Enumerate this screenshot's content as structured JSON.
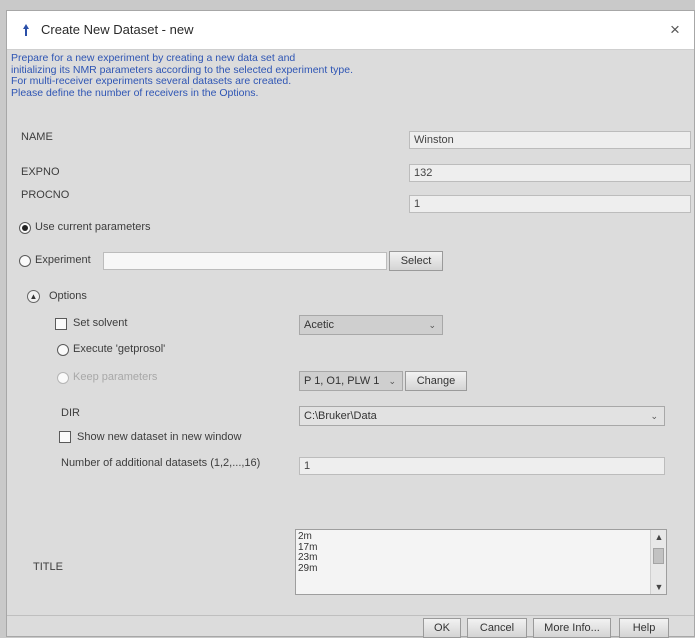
{
  "window": {
    "title": "Create New Dataset - new",
    "close_glyph": "×"
  },
  "info_lines": [
    "Prepare for a new experiment by creating a new data set and",
    "initializing its NMR parameters according to the selected experiment type.",
    "For multi-receiver experiments several datasets are created.",
    "Please define the number of receivers in the Options."
  ],
  "fields": {
    "name": {
      "label": "NAME",
      "value": "Winston"
    },
    "expno": {
      "label": "EXPNO",
      "value": "132"
    },
    "procno": {
      "label": "PROCNO",
      "value": "1"
    }
  },
  "source": {
    "use_current": {
      "label": "Use current parameters",
      "selected": true
    },
    "experiment": {
      "label": "Experiment",
      "value": "",
      "select_label": "Select"
    }
  },
  "options": {
    "label": "Options",
    "expanded": true,
    "set_solvent": {
      "label": "Set solvent",
      "checked": false,
      "value": "Acetic"
    },
    "execute_getprosol": {
      "label": "Execute 'getprosol'"
    },
    "keep_parameters": {
      "label": "Keep parameters",
      "value": "P 1, O1, PLW 1",
      "change_label": "Change"
    },
    "dir": {
      "label": "DIR",
      "value": "C:\\Bruker\\Data"
    },
    "show_new_dataset": {
      "label": "Show new dataset in new window",
      "checked": false
    },
    "additional": {
      "label": "Number of additional datasets (1,2,...,16)",
      "value": "1"
    }
  },
  "title_field": {
    "label": "TITLE",
    "lines": [
      "2m",
      "17m",
      "23m",
      "29m"
    ]
  },
  "buttons": {
    "ok": "OK",
    "cancel": "Cancel",
    "more_info": "More Info...",
    "help": "Help"
  },
  "icons": {
    "app": "bruker-app-icon",
    "dropdown": "chevron-down-icon"
  }
}
